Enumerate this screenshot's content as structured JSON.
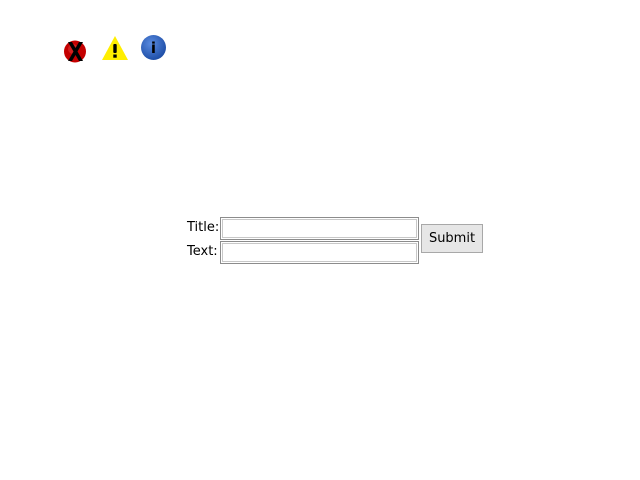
{
  "toolbar": {
    "icons": [
      {
        "name": "error-icon",
        "color": "#cc0000"
      },
      {
        "name": "warning-icon",
        "color": "#ffee00"
      },
      {
        "name": "info-icon",
        "color": "#2f5fb5",
        "glyph": "i"
      }
    ]
  },
  "form": {
    "title_label": "Title:",
    "text_label": "Text:",
    "title_value": "",
    "text_value": "",
    "submit_label": "Submit"
  }
}
